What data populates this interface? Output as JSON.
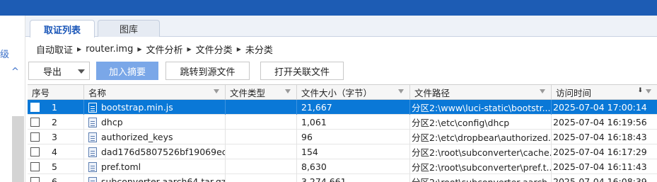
{
  "left_panel": {
    "glyph": "级",
    "chevron": "^"
  },
  "tabs": [
    {
      "label": "取证列表"
    },
    {
      "label": "图库"
    }
  ],
  "breadcrumb": [
    "自动取证",
    "router.img",
    "文件分析",
    "文件分类",
    "未分类"
  ],
  "toolbar": {
    "export_label": "导出",
    "add_summary_label": "加入摘要",
    "jump_label": "跳转到源文件",
    "open_label": "打开关联文件"
  },
  "table": {
    "columns": [
      "序号",
      "名称",
      "文件类型",
      "文件大小（字节）",
      "文件路径",
      "访问时间"
    ],
    "rows": [
      {
        "no": "1",
        "name": "bootstrap.min.js",
        "type": "",
        "size": "21,667",
        "path": "分区2:\\www\\luci-static\\bootstr...",
        "time": "2025-07-04 17:00:14",
        "selected": true
      },
      {
        "no": "2",
        "name": "dhcp",
        "type": "",
        "size": "1,061",
        "path": "分区2:\\etc\\config\\dhcp",
        "time": "2025-07-04 16:19:56",
        "selected": false
      },
      {
        "no": "3",
        "name": "authorized_keys",
        "type": "",
        "size": "96",
        "path": "分区2:\\etc\\dropbear\\authorized...",
        "time": "2025-07-04 16:18:43",
        "selected": false
      },
      {
        "no": "4",
        "name": "dad176d5807526bf19069ec...",
        "type": "",
        "size": "154",
        "path": "分区2:\\root\\subconverter\\cache...",
        "time": "2025-07-04 16:17:29",
        "selected": false
      },
      {
        "no": "5",
        "name": "pref.toml",
        "type": "",
        "size": "8,630",
        "path": "分区2:\\root\\subconverter\\pref.t...",
        "time": "2025-07-04 16:11:43",
        "selected": false
      },
      {
        "no": "6",
        "name": "subconverter-aarch64.tar.gz",
        "type": "",
        "size": "3,274,661",
        "path": "分区2:\\root\\subconverter-aarch...",
        "time": "2025-07-04 16:08:39",
        "selected": false
      }
    ]
  },
  "colors": {
    "topbar": "#1d5cb4",
    "selection": "#0a78d7",
    "primary_button": "#7aa7e8",
    "active_tab_text": "#1a56b8"
  }
}
